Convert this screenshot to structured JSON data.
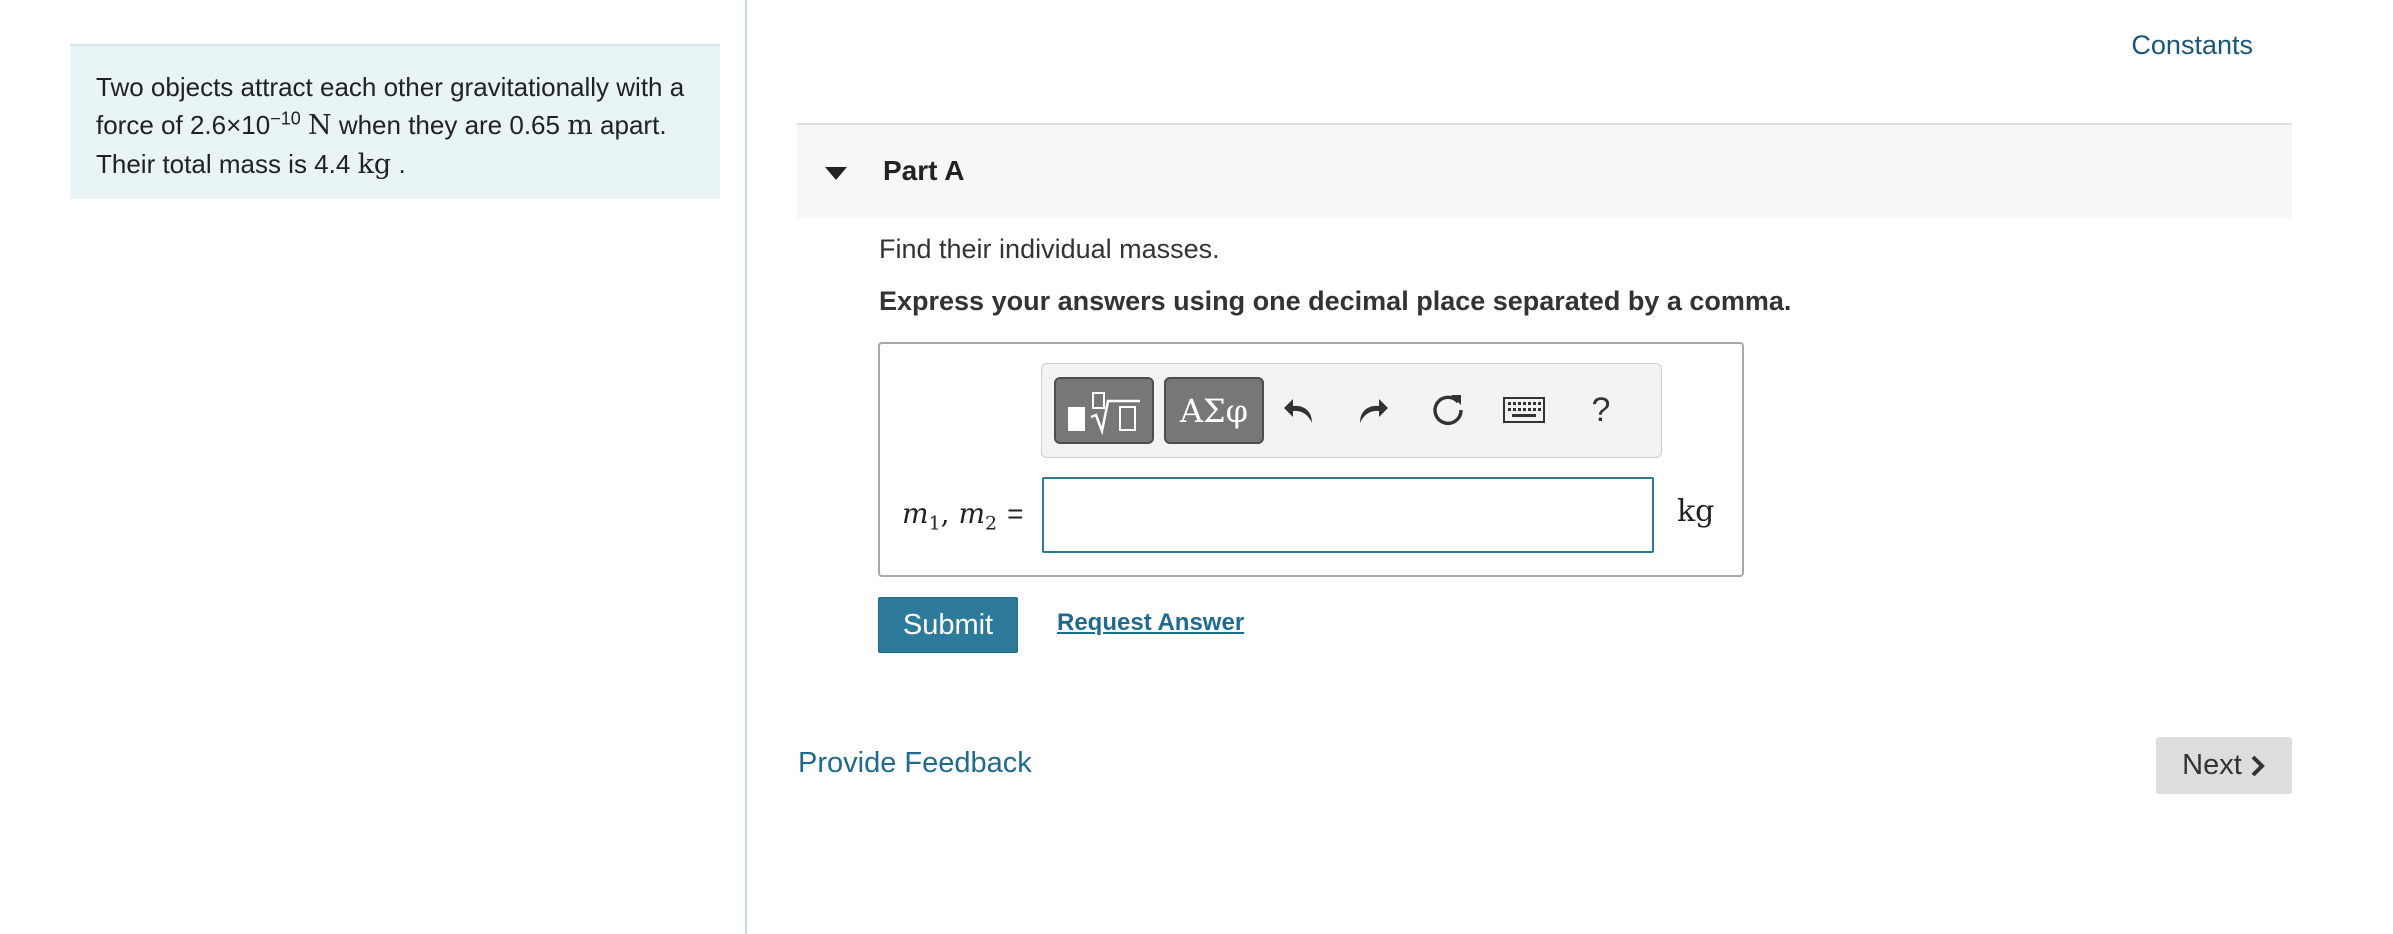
{
  "problem": {
    "line1": "Two objects attract each other gravitationally with a",
    "line2_prefix": "force of ",
    "force_coef": "2.6×10",
    "force_exp": "−10",
    "force_unit": "N",
    "line2_mid": " when they are ",
    "distance_value": "0.65",
    "distance_unit": "m",
    "line2_suffix": " apart.",
    "line3_prefix": "Their total mass is ",
    "mass_value": "4.4",
    "mass_unit": "kg",
    "line3_suffix": " ."
  },
  "header": {
    "constants_label": "Constants"
  },
  "part": {
    "title": "Part A",
    "question": "Find their individual masses.",
    "instruction": "Express your answers using one decimal place separated by a comma."
  },
  "toolbar": {
    "greek_label": "ΑΣφ",
    "help_label": "?",
    "icons": [
      "templates-icon",
      "greek-symbols-icon",
      "undo-icon",
      "redo-icon",
      "reset-icon",
      "keyboard-icon",
      "help-icon"
    ]
  },
  "answer": {
    "var1": "m",
    "var1_sub": "1",
    "var2": "m",
    "var2_sub": "2",
    "separator": ",",
    "equals": "=",
    "input_value": "",
    "unit": "kg"
  },
  "actions": {
    "submit_label": "Submit",
    "request_label": "Request Answer",
    "feedback_label": "Provide Feedback",
    "next_label": "Next"
  },
  "colors": {
    "accent": "#2d7a9a",
    "link": "#1f6b8f",
    "problem_bg": "#e9f4f6",
    "toolbar_button": "#777777"
  }
}
